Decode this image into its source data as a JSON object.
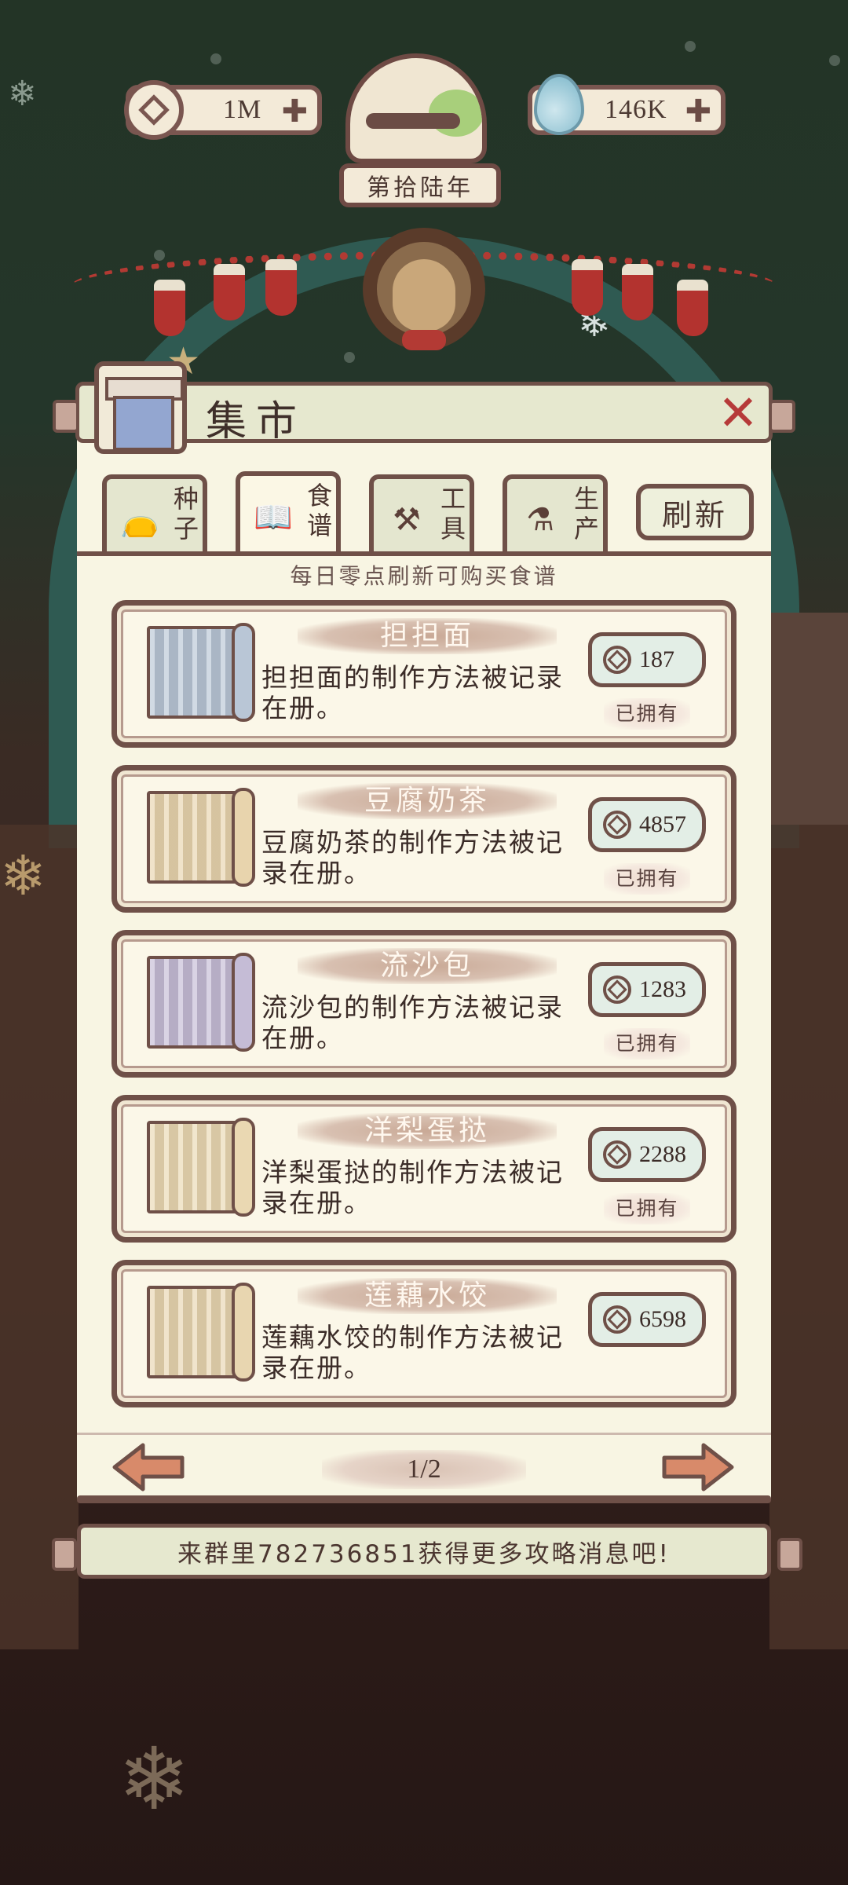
{
  "hud": {
    "coins": "1M",
    "water": "146K",
    "year": "第拾陆年"
  },
  "panel": {
    "title": "集市",
    "tabs": [
      {
        "line1": "种",
        "line2": "子"
      },
      {
        "line1": "食",
        "line2": "谱"
      },
      {
        "line1": "工",
        "line2": "具"
      },
      {
        "line1": "生",
        "line2": "产"
      }
    ],
    "active_tab": 1,
    "refresh_label": "刷新",
    "hint": "每日零点刷新可购买食谱"
  },
  "recipes": [
    {
      "name": "担担面",
      "desc_l1": "担担面的制作方法被记录",
      "desc_l2": "在册。",
      "price": "187",
      "owned": "已拥有",
      "scroll_color": "#b9c6d6"
    },
    {
      "name": "豆腐奶茶",
      "desc_l1": "豆腐奶茶的制作方法被记",
      "desc_l2": "录在册。",
      "price": "4857",
      "owned": "已拥有",
      "scroll_color": "#e8d4ad"
    },
    {
      "name": "流沙包",
      "desc_l1": "流沙包的制作方法被记录",
      "desc_l2": "在册。",
      "price": "1283",
      "owned": "已拥有",
      "scroll_color": "#c5bcd6"
    },
    {
      "name": "洋梨蛋挞",
      "desc_l1": "洋梨蛋挞的制作方法被记",
      "desc_l2": "录在册。",
      "price": "2288",
      "owned": "已拥有",
      "scroll_color": "#ead8b2"
    },
    {
      "name": "莲藕水饺",
      "desc_l1": "莲藕水饺的制作方法被记",
      "desc_l2": "录在册。",
      "price": "6598",
      "owned": "",
      "scroll_color": "#e8d6b0"
    }
  ],
  "pager": {
    "label": "1/2"
  },
  "footer": {
    "text": "来群里782736851获得更多攻略消息吧!"
  },
  "colors": {
    "accent_brown": "#6f5048",
    "close_red": "#b63a39",
    "arrow_orange": "#d88a6a"
  }
}
